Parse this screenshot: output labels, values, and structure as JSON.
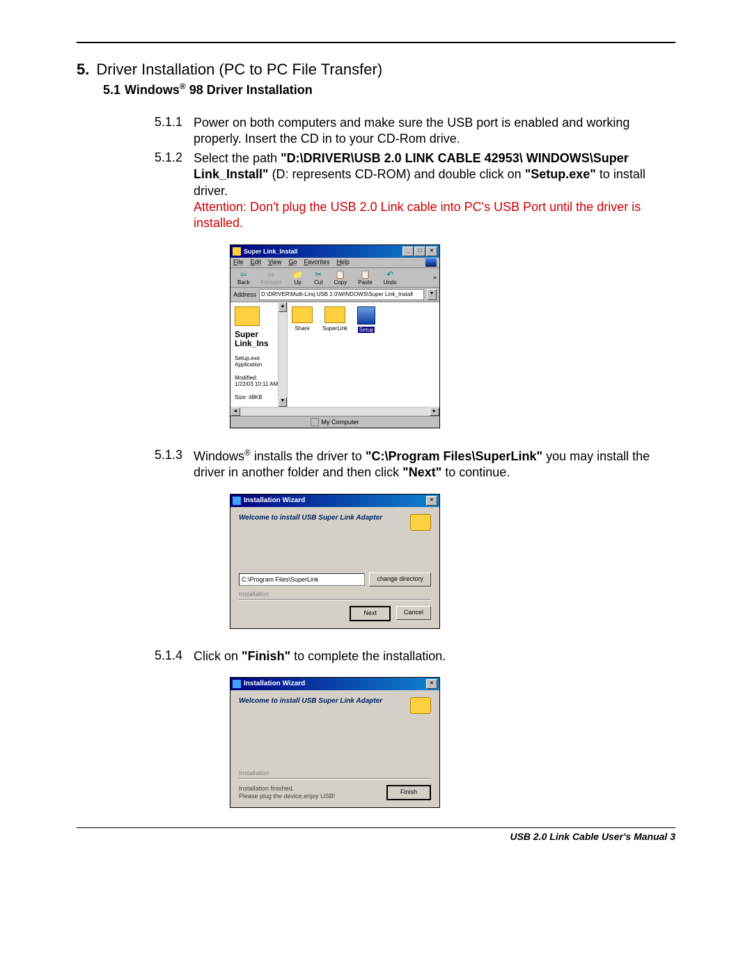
{
  "section": {
    "number": "5.",
    "title": "Driver Installation (PC to PC File Transfer)"
  },
  "subsection": {
    "number": "5.1",
    "title_pre": "Windows",
    "title_post": " 98 Driver Installation"
  },
  "steps": {
    "s511": {
      "num": "5.1.1",
      "text": "Power on both computers and make sure the USB port is enabled and working properly. Insert the CD in to your CD-Rom drive."
    },
    "s512": {
      "num": "5.1.2",
      "pre": "Select the path ",
      "path": "\"D:\\DRIVER\\USB 2.0 LINK CABLE 42953\\ WINDOWS\\Super Link_Install\"",
      "mid": " (D: represents CD-ROM) and double click on ",
      "setup": "\"Setup.exe\"",
      "post": " to install driver.",
      "warn": "Attention: Don't plug the USB 2.0 Link cable into PC's USB Port until the driver is installed."
    },
    "s513": {
      "num": "5.1.3",
      "pre": "Windows",
      "mid1": " installs the driver to ",
      "path": "\"C:\\Program Files\\SuperLink\"",
      "mid2": " you may install the driver in another folder and then click ",
      "next": "\"Next\"",
      "post": " to continue."
    },
    "s514": {
      "num": "5.1.4",
      "pre": "Click on ",
      "finish": "\"Finish\"",
      "post": " to complete the installation."
    }
  },
  "explorer": {
    "title": "Super Link_Install",
    "menus": [
      "File",
      "Edit",
      "View",
      "Go",
      "Favorites",
      "Help"
    ],
    "toolbar": {
      "back": "Back",
      "forward": "Forward",
      "up": "Up",
      "cut": "Cut",
      "copy": "Copy",
      "paste": "Paste",
      "undo": "Undo"
    },
    "address_label": "Address",
    "address": "D:\\DRIVER\\Multi-Linq USB 2.0\\WINDOWS\\Super Link_Install",
    "left": {
      "name_l1": "Super",
      "name_l2": "Link_Ins",
      "file_name": "Setup.exe",
      "file_type": "Application",
      "modified_label": "Modified:",
      "modified": "1/22/03 10:11 AM",
      "size": "Size: 48KB"
    },
    "items": {
      "share": "Share",
      "superlink": "SuperLink",
      "setup": "Setup"
    },
    "status": "My Computer"
  },
  "wizard1": {
    "title": "Installation   Wizard",
    "welcome": "Welcome to install USB Super Link Adapter",
    "path": "C:\\Program Files\\SuperLink",
    "change": "change directory",
    "group": "Installation",
    "next": "Next",
    "cancel": "Cancel"
  },
  "wizard2": {
    "title": "Installation   Wizard",
    "welcome": "Welcome to install USB Super Link Adapter",
    "group": "Installation",
    "line1": "Installation finished.",
    "line2": "Please plug the device,enjoy USB!",
    "finish": "Finish"
  },
  "footer": "USB 2.0 Link Cable User's Manual 3"
}
